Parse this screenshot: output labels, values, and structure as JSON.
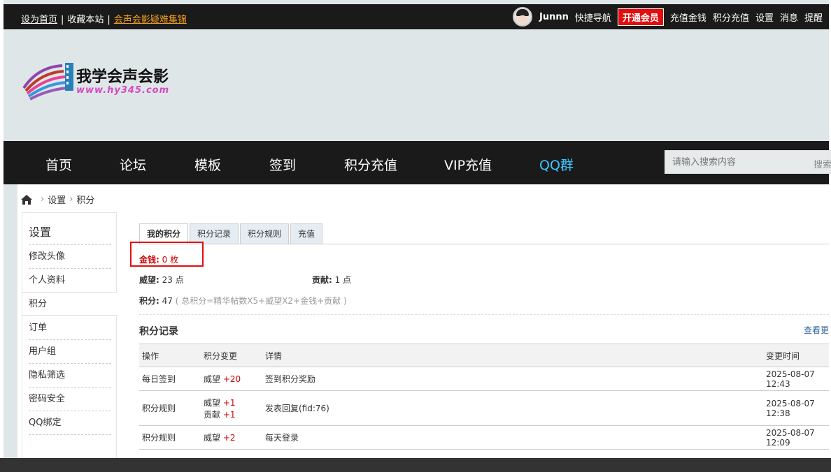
{
  "topbar": {
    "set_home": "设为首页",
    "bookmark": "收藏本站",
    "faq_link": "会声会影疑难集锦",
    "username": "Junnn",
    "quick_nav": "快捷导航",
    "vip_button": "开通会员",
    "recharge_money": "充值金钱",
    "recharge_points": "积分充值",
    "settings": "设置",
    "messages": "消息",
    "reminders": "提醒"
  },
  "logo": {
    "title": "我学会声会影",
    "url": "www.hy345.com"
  },
  "nav": {
    "items": [
      "首页",
      "论坛",
      "模板",
      "签到",
      "积分充值",
      "VIP充值",
      "QQ群"
    ],
    "search_placeholder": "请输入搜索内容",
    "search_button": "搜索"
  },
  "breadcrumb": {
    "items": [
      "设置",
      "积分"
    ]
  },
  "sidebar": {
    "title": "设置",
    "items": [
      "修改头像",
      "个人资料",
      "积分",
      "订单",
      "用户组",
      "隐私筛选",
      "密码安全",
      "QQ绑定"
    ]
  },
  "tabs": [
    "我的积分",
    "积分记录",
    "积分规则",
    "充值"
  ],
  "stats": {
    "money_label": "金钱:",
    "money_value": "0 枚",
    "prestige_label": "威望:",
    "prestige_value": "23 点",
    "contribution_label": "贡献:",
    "contribution_value": "1 点",
    "total_label": "积分:",
    "total_value": "47",
    "total_note": "( 总积分=精华帖数X5+威望X2+金钱+贡献 )"
  },
  "records": {
    "title": "积分记录",
    "view_more": "查看更",
    "columns": [
      "操作",
      "积分变更",
      "详情",
      "变更时间"
    ],
    "rows": [
      {
        "action": "每日签到",
        "changes": [
          {
            "name": "威望",
            "delta": "+20"
          }
        ],
        "detail": "签到积分奖励",
        "time": "2025-08-07 12:43"
      },
      {
        "action": "积分规则",
        "changes": [
          {
            "name": "威望",
            "delta": "+1"
          },
          {
            "name": "贡献",
            "delta": "+1"
          }
        ],
        "detail": "发表回复(fid:76)",
        "time": "2025-08-07 12:38"
      },
      {
        "action": "积分规则",
        "changes": [
          {
            "name": "威望",
            "delta": "+2"
          }
        ],
        "detail": "每天登录",
        "time": "2025-08-07 12:09"
      }
    ]
  },
  "colors": {
    "topbar_bg": "#1a1a1a",
    "nav_bg": "#1a1a1a",
    "header_bg": "#dfe6e8",
    "accent_red": "#e30d0d",
    "qq_blue": "#3ec6ff",
    "faq_orange": "#f7a21b"
  }
}
